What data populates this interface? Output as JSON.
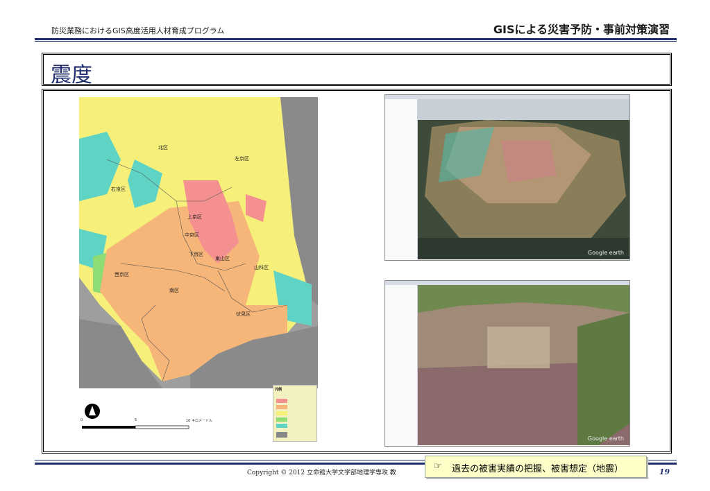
{
  "header": {
    "left": "防災業務におけるGIS高度活用人材育成プログラム",
    "right": "GISによる災害予防・事前対策演習"
  },
  "title": "震度",
  "map": {
    "wards": [
      "北区",
      "左京区",
      "右京区",
      "上京区",
      "中京区",
      "下京区",
      "東山区",
      "山科区",
      "西京区",
      "南区",
      "伏見区"
    ],
    "scale_labels": [
      "0",
      "5",
      "10 キロメートル"
    ],
    "legend_title": "凡例"
  },
  "ge": {
    "logo": "Google earth"
  },
  "footer": {
    "copyright": "Copyright © 2012 立命館大学文学部地理学専攻 教",
    "callout_icon": "☞",
    "callout_text": "過去の被害実績の把握、被害想定（地震）",
    "page": "19"
  },
  "colors": {
    "navy": "#1f2d6e"
  }
}
